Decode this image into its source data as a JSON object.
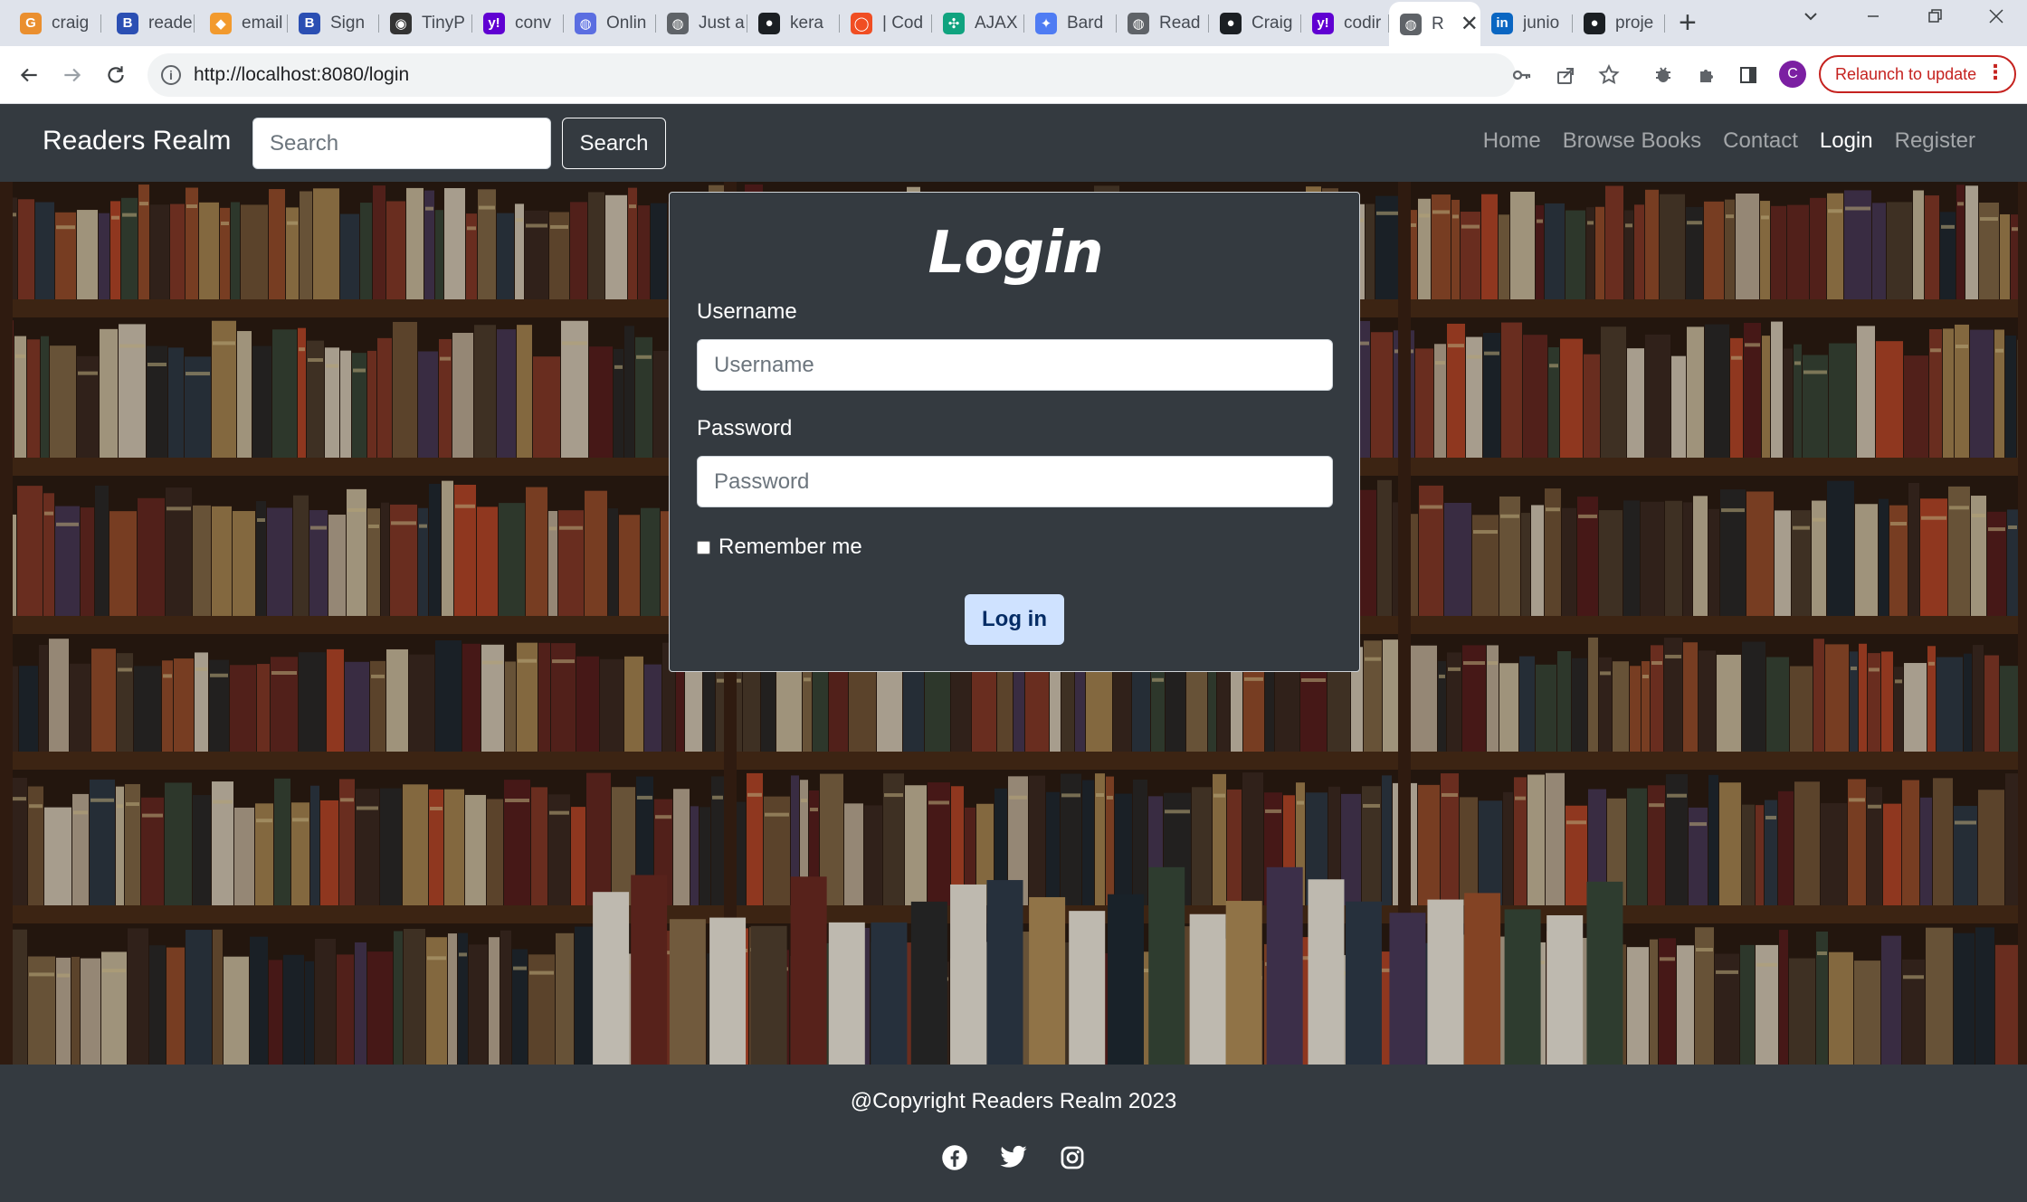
{
  "browser": {
    "tabs": [
      {
        "label": "craig",
        "icon": "google-icon",
        "color": "#ea8f2f"
      },
      {
        "label": "reade",
        "icon": "bootstrap-shield-icon",
        "color": "#2b4fb3"
      },
      {
        "label": "email",
        "icon": "app-icon",
        "color": "#f29a2e"
      },
      {
        "label": "Sign",
        "icon": "bootstrap-shield-icon",
        "color": "#2b4fb3"
      },
      {
        "label": "TinyP",
        "icon": "panda-icon",
        "color": "#333333"
      },
      {
        "label": "conv",
        "icon": "yahoo-icon",
        "color": "#6001d2"
      },
      {
        "label": "Onlin",
        "icon": "globe-icon",
        "color": "#5b6ee1"
      },
      {
        "label": "Just a",
        "icon": "globe-icon",
        "color": "#5f6368"
      },
      {
        "label": "kera",
        "icon": "github-icon",
        "color": "#1b1f23"
      },
      {
        "label": "| Cod",
        "icon": "circle-icon",
        "color": "#f04e23"
      },
      {
        "label": "AJAX",
        "icon": "openai-icon",
        "color": "#10a37f"
      },
      {
        "label": "Bard",
        "icon": "bard-icon",
        "color": "#4f7cf3"
      },
      {
        "label": "Read",
        "icon": "globe-icon",
        "color": "#5f6368"
      },
      {
        "label": "Craig",
        "icon": "github-icon",
        "color": "#1b1f23"
      },
      {
        "label": "codir",
        "icon": "yahoo-icon",
        "color": "#6001d2"
      },
      {
        "label": "R",
        "icon": "globe-icon",
        "color": "#5f6368",
        "active": true
      },
      {
        "label": "junio",
        "icon": "linkedin-icon",
        "color": "#0a66c2"
      },
      {
        "label": "proje",
        "icon": "github-icon",
        "color": "#1b1f23"
      }
    ],
    "url": "http://localhost:8080/login",
    "profile_initial": "C",
    "relaunch_label": "Relaunch to update"
  },
  "navbar": {
    "brand": "Readers Realm",
    "search_placeholder": "Search",
    "search_button": "Search",
    "links": [
      {
        "label": "Home",
        "active": false
      },
      {
        "label": "Browse Books",
        "active": false
      },
      {
        "label": "Contact",
        "active": false
      },
      {
        "label": "Login",
        "active": true
      },
      {
        "label": "Register",
        "active": false
      }
    ]
  },
  "login": {
    "title": "Login",
    "username_label": "Username",
    "username_placeholder": "Username",
    "password_label": "Password",
    "password_placeholder": "Password",
    "remember_label": "Remember me",
    "remember_checked": false,
    "submit_label": "Log in"
  },
  "footer": {
    "copyright": "@Copyright Readers Realm 2023",
    "socials": [
      "facebook-icon",
      "twitter-icon",
      "instagram-icon"
    ]
  },
  "colors": {
    "navbar_bg": "#343a40",
    "login_button_bg": "#cfe2ff",
    "login_button_text": "#052c65"
  }
}
